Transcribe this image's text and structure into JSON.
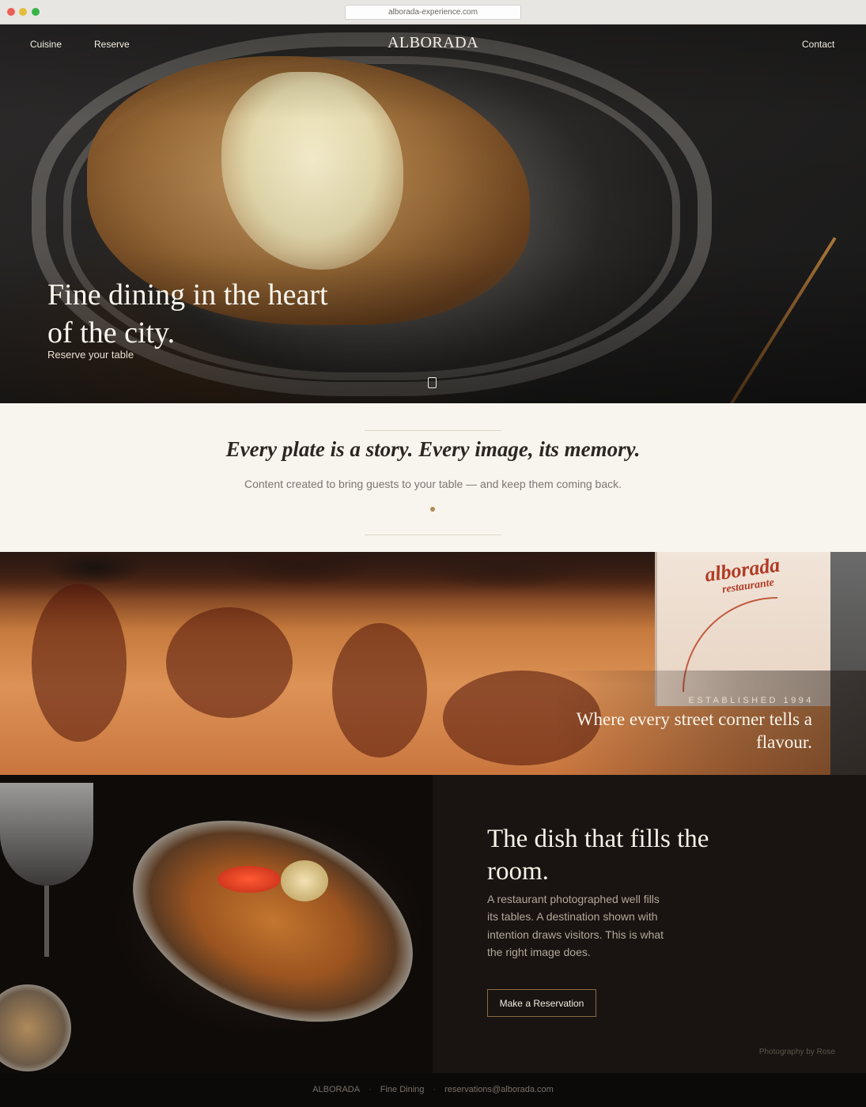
{
  "browser": {
    "url": "alborada-experience.com"
  },
  "nav": {
    "cuisine": "Cuisine",
    "reserve": "Reserve",
    "brand": "ALBORADA",
    "contact": "Contact"
  },
  "hero": {
    "title": "Fine dining in the heart of the city.",
    "cta": "Reserve your table"
  },
  "tagline": {
    "heading": "Every plate is a story. Every image, its memory.",
    "sub": "Content created to bring guests to your table — and keep them coming back."
  },
  "street": {
    "sign_name": "alborada",
    "sign_sub": "restaurante",
    "eyebrow": "ESTABLISHED 1994",
    "title": "Where every street corner tells a flavour."
  },
  "dish": {
    "title": "The dish that fills the room.",
    "body": "A restaurant photographed well fills its tables. A destination shown with intention draws visitors. This is what the right image does.",
    "button": "Make a Reservation",
    "credit": "Photography by Rose"
  },
  "footer": {
    "brand": "ALBORADA",
    "category": "Fine Dining",
    "email": "reservations@alborada.com"
  }
}
